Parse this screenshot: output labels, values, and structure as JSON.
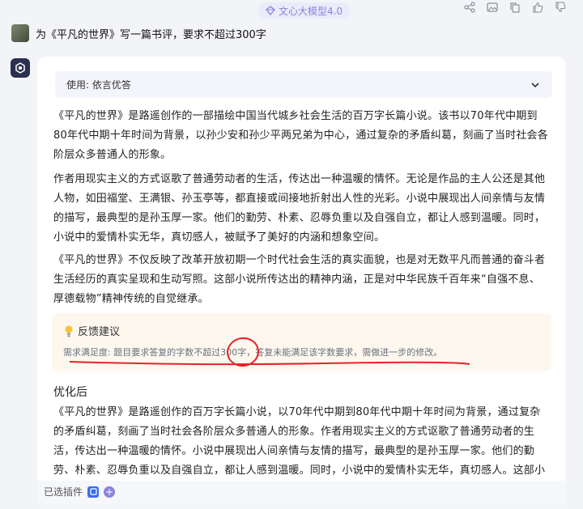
{
  "header": {
    "model_name": "文心大模型4.0",
    "actions": [
      "share-icon",
      "image-icon",
      "copy-icon",
      "thumbs-up-icon",
      "thumbs-down-icon"
    ]
  },
  "user_message": "为《平凡的世界》写一篇书评，要求不超过300字",
  "response": {
    "use_label": "使用: 依言优答",
    "paragraphs": [
      "《平凡的世界》是路遥创作的一部描绘中国当代城乡社会生活的百万字长篇小说。该书以70年代中期到80年代中期十年时间为背景，以孙少安和孙少平两兄弟为中心，通过复杂的矛盾纠葛，刻画了当时社会各阶层众多普通人的形象。",
      "作者用现实主义的方式讴歌了普通劳动者的生活，传达出一种温暖的情怀。无论是作品的主人公还是其他人物，如田福堂、王满银、孙玉亭等，都直接或间接地折射出人性的光彩。小说中展现出人间亲情与友情的描写，最典型的是孙玉厚一家。他们的勤劳、朴素、忍辱负重以及自强自立，都让人感到温暖。同时，小说中的爱情朴实无华，真切感人，被赋予了美好的内涵和想象空间。",
      "《平凡的世界》不仅反映了改革开放初期一个时代社会生活的真实面貌，也是对无数平凡而普通的奋斗者生活经历的真实呈现和生动写照。这部小说所传达出的精神内涵，正是对中华民族千百年来“自强不息、厚德载物”精神传统的自觉继承。"
    ],
    "feedback": {
      "title": "反馈建议",
      "key": "需求满足度:",
      "text": "题目要求答复的字数不超过300字，答复未能满足该字数要求，需做进一步的修改。"
    },
    "optimized_title": "优化后",
    "optimized_text": "《平凡的世界》是路遥创作的百万字长篇小说，以70年代中期到80年代中期十年时间为背景，通过复杂的矛盾纠葛，刻画了当时社会各阶层众多普通人的形象。作者用现实主义的方式讴歌了普通劳动者的生活，传达出一种温暖的情怀。小说中展现出人间亲情与友情的描写，最典型的是孙玉厚一家。他们的勤劳、朴素、忍辱负重以及自强自立，都让人感到温暖。同时，小说中的爱情朴实无华，真切感人。这部小说不仅反映了改革开放初期一个时"
  },
  "bottom": {
    "plugins_label": "已选插件"
  },
  "colors": {
    "accent": "#8a84d8",
    "annotation_red": "#e8222a",
    "feedback_bg": "#fdf7ee"
  }
}
